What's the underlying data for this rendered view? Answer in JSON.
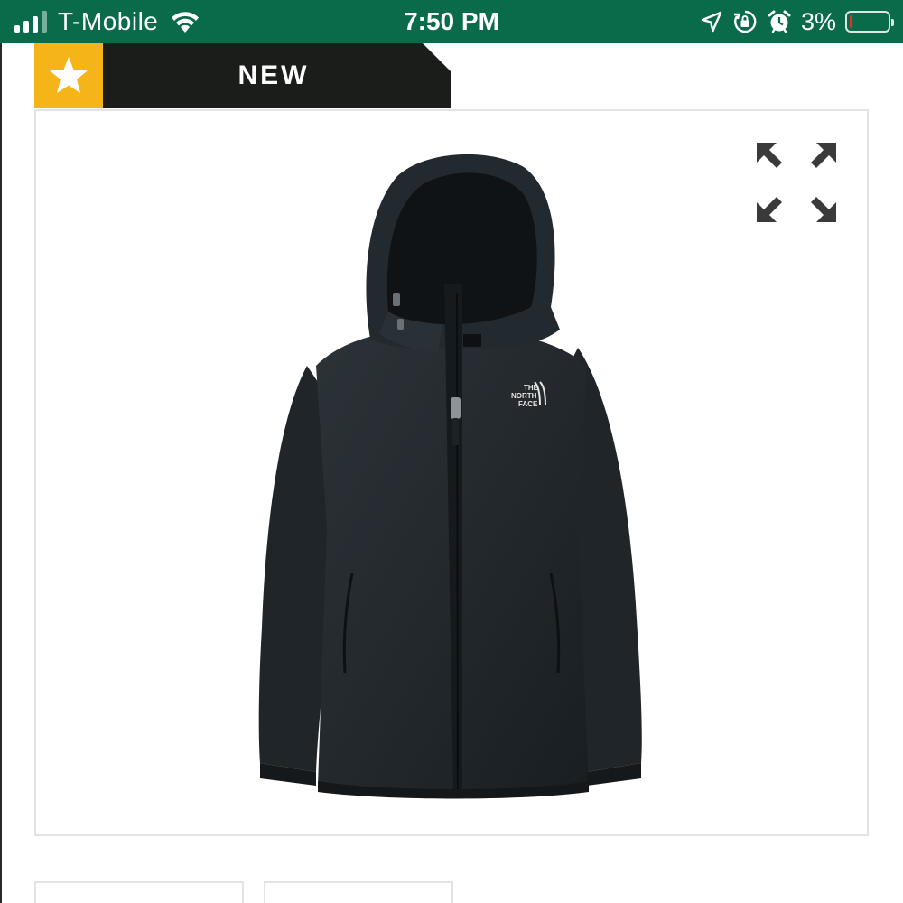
{
  "status_bar": {
    "carrier": "T-Mobile",
    "time": "7:50 PM",
    "battery_percent": "3%",
    "battery_level": 0.03,
    "icons": [
      "cellular-signal-icon",
      "wifi-icon",
      "location-arrow-icon",
      "orientation-lock-icon",
      "alarm-icon",
      "battery-icon"
    ],
    "background_color": "#0a6b4b"
  },
  "badge": {
    "icon": "star-icon",
    "label": "NEW",
    "star_bg_color": "#f5b417",
    "label_bg_color": "#1b1d1b"
  },
  "product_image": {
    "expand_icon": "fullscreen-expand-icon",
    "jacket_logo_lines": [
      "THE",
      "NORTH",
      "FACE"
    ]
  },
  "thumbnails": {
    "count": 2
  }
}
